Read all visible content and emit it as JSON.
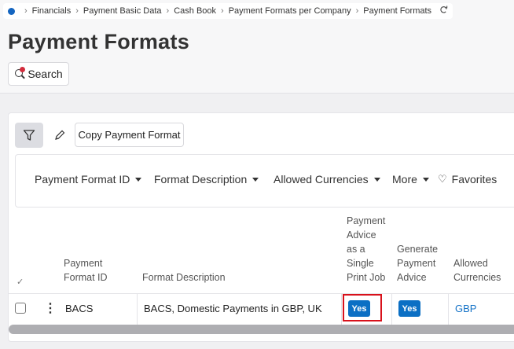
{
  "breadcrumb": {
    "items": [
      "Financials",
      "Payment Basic Data",
      "Cash Book",
      "Payment Formats per Company",
      "Payment Formats"
    ]
  },
  "page": {
    "title": "Payment Formats"
  },
  "search": {
    "label": "Search"
  },
  "toolbar": {
    "copy_label": "Copy Payment Format"
  },
  "column_selector": {
    "options": [
      "Payment Format ID",
      "Format Description",
      "Allowed Currencies",
      "More"
    ],
    "favorites_label": "Favorites"
  },
  "table": {
    "headers": {
      "payment_format_id": [
        "Payment",
        "Format ID"
      ],
      "format_description": "Format Description",
      "advice_single_print": [
        "Payment",
        "Advice",
        "as a",
        "Single",
        "Print Job"
      ],
      "generate_advice": [
        "Generate",
        "Payment",
        "Advice"
      ],
      "allowed_currencies": [
        "Allowed",
        "Currencies"
      ]
    },
    "rows": [
      {
        "payment_format_id": "BACS",
        "format_description": "BACS, Domestic Payments in GBP, UK",
        "advice_single_print": "Yes",
        "generate_advice": "Yes",
        "allowed_currencies": "GBP"
      }
    ]
  },
  "icons": {
    "home": "home-dot-icon",
    "refresh": "refresh-icon",
    "search": "search-icon",
    "filter": "filter-icon",
    "edit": "pencil-icon",
    "favorites": "heart-icon",
    "row_menu": "kebab-menu-icon"
  },
  "colors": {
    "accent": "#0b6fc4",
    "link": "#1573c7",
    "highlight": "#d8111b",
    "notification_dot": "#d22c3c"
  }
}
